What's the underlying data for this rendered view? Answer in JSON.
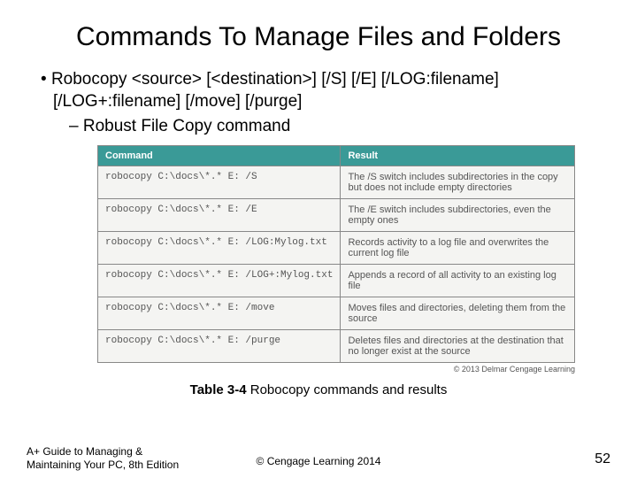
{
  "title": "Commands To Manage Files and Folders",
  "bullet1": "Robocopy <source> [<destination>] [/S] [/E] [/LOG:filename] [/LOG+:filename] [/move] [/purge]",
  "bullet2": "Robust File Copy command",
  "table": {
    "head_command": "Command",
    "head_result": "Result",
    "rows": [
      {
        "cmd": "robocopy C:\\docs\\*.* E: /S",
        "res": "The /S switch includes subdirectories in the copy but does not include empty directories"
      },
      {
        "cmd": "robocopy C:\\docs\\*.* E: /E",
        "res": "The /E switch includes subdirectories, even the empty ones"
      },
      {
        "cmd": "robocopy C:\\docs\\*.* E: /LOG:Mylog.txt",
        "res": "Records activity to a log file and overwrites the current log file"
      },
      {
        "cmd": "robocopy C:\\docs\\*.* E: /LOG+:Mylog.txt",
        "res": "Appends a record of all activity to an existing log file"
      },
      {
        "cmd": "robocopy C:\\docs\\*.* E: /move",
        "res": "Moves files and directories, deleting them from the source"
      },
      {
        "cmd": "robocopy C:\\docs\\*.* E: /purge",
        "res": "Deletes files and directories at the destination that no longer exist at the source"
      }
    ]
  },
  "img_copyright": "© 2013 Delmar Cengage Learning",
  "caption_bold": "Table 3-4",
  "caption_rest": " Robocopy commands and results",
  "footer_left": "A+ Guide to Managing & Maintaining Your PC, 8th Edition",
  "footer_center": "© Cengage Learning  2014",
  "page_number": "52"
}
